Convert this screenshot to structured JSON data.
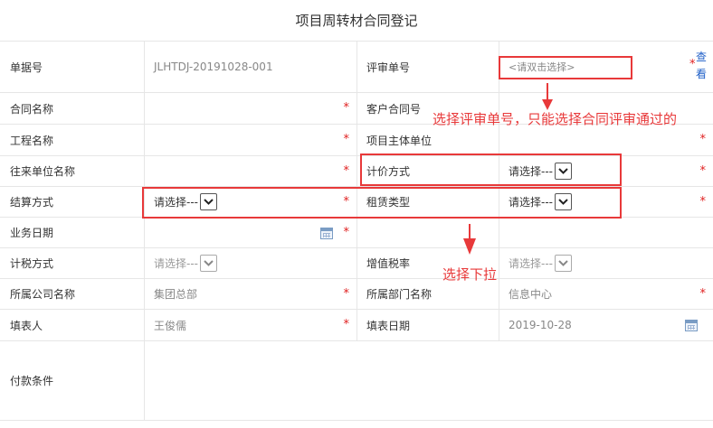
{
  "form": {
    "title": "项目周转材合同登记",
    "required_mark": "*",
    "rows": {
      "doc_no": {
        "label": "单据号",
        "value": "JLHTDJ-20191028-001"
      },
      "review_no": {
        "label": "评审单号",
        "placeholder": "<请双击选择>",
        "view_link": "查看"
      },
      "contract_name": {
        "label": "合同名称"
      },
      "customer_contract_no": {
        "label": "客户合同号"
      },
      "project_name": {
        "label": "工程名称"
      },
      "project_entity": {
        "label": "项目主体单位"
      },
      "partner_unit": {
        "label": "往来单位名称"
      },
      "pricing_method": {
        "label": "计价方式",
        "select_value": "请选择---"
      },
      "settlement_method": {
        "label": "结算方式",
        "select_value": "请选择---"
      },
      "lease_type": {
        "label": "租赁类型",
        "select_value": "请选择---"
      },
      "business_date": {
        "label": "业务日期"
      },
      "tax_method": {
        "label": "计税方式",
        "select_value": "请选择---"
      },
      "vat_rate": {
        "label": "增值税率",
        "select_value": "请选择---"
      },
      "company": {
        "label": "所属公司名称",
        "value": "集团总部"
      },
      "department": {
        "label": "所属部门名称",
        "value": "信息中心"
      },
      "filler": {
        "label": "填表人",
        "value": "王俊儒"
      },
      "fill_date": {
        "label": "填表日期",
        "value": "2019-10-28"
      },
      "payment_terms": {
        "label": "付款条件"
      }
    }
  },
  "annotations": {
    "review_note": "选择评审单号，只能选择合同评审通过的",
    "dropdown_note": "选择下拉",
    "color": "#e8393a"
  },
  "icons": {
    "calendar": "calendar-icon",
    "dropdown": "chevron-down-icon"
  }
}
